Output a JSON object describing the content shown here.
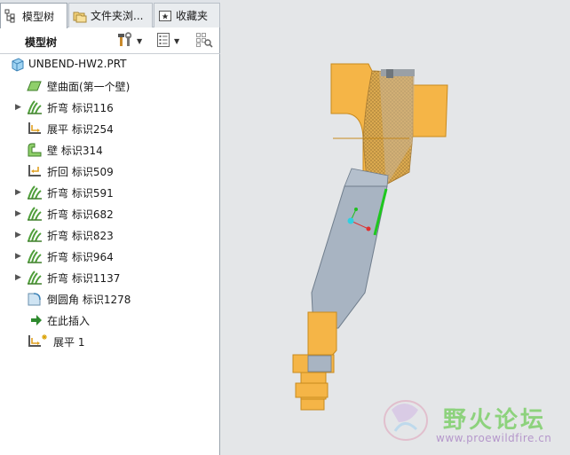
{
  "tabs": [
    {
      "label": "模型树",
      "icon": "model-tree-icon",
      "active": true
    },
    {
      "label": "文件夹浏...",
      "icon": "folder-browser-icon",
      "active": false
    },
    {
      "label": "收藏夹",
      "icon": "favorites-icon",
      "active": false
    }
  ],
  "panel": {
    "title": "模型树"
  },
  "tree": [
    {
      "label": "UNBEND-HW2.PRT",
      "icon": "part-icon",
      "expandable": false
    },
    {
      "label": "壁曲面(第一个壁)",
      "icon": "flat-wall-icon",
      "expandable": false
    },
    {
      "label": "折弯 标识116",
      "icon": "bend-icon",
      "expandable": true
    },
    {
      "label": "展平 标识254",
      "icon": "unbend-icon",
      "expandable": false
    },
    {
      "label": "壁 标识314",
      "icon": "wall-icon",
      "expandable": false
    },
    {
      "label": "折回 标识509",
      "icon": "bend-back-icon",
      "expandable": false
    },
    {
      "label": "折弯 标识591",
      "icon": "bend-icon",
      "expandable": true
    },
    {
      "label": "折弯 标识682",
      "icon": "bend-icon",
      "expandable": true
    },
    {
      "label": "折弯 标识823",
      "icon": "bend-icon",
      "expandable": true
    },
    {
      "label": "折弯 标识964",
      "icon": "bend-icon",
      "expandable": true
    },
    {
      "label": "折弯 标识1137",
      "icon": "bend-icon",
      "expandable": true
    },
    {
      "label": "倒圆角 标识1278",
      "icon": "round-icon",
      "expandable": false
    },
    {
      "label": "在此插入",
      "icon": "insert-here-arrow-icon",
      "expandable": false
    },
    {
      "label": "展平 1",
      "icon": "unbend-new-icon",
      "expandable": false
    }
  ],
  "watermark": {
    "text": "野火论坛",
    "url": "www.proewildfire.cn"
  },
  "colors": {
    "part_orange": "#f5b547",
    "part_gray": "#a8b4c2",
    "selected_edge": "#1ec81e",
    "viewport_bg": "#e4e6e8"
  }
}
